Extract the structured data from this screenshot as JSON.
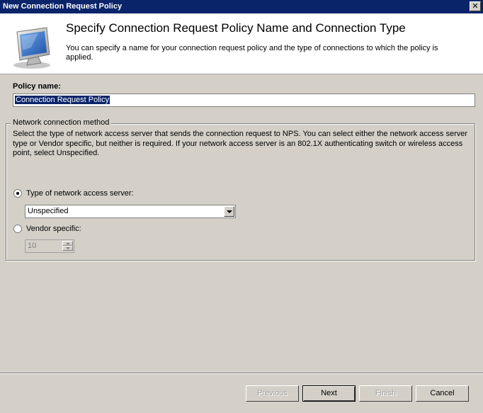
{
  "window": {
    "title": "New Connection Request Policy",
    "close_glyph": "✕"
  },
  "header": {
    "icon": "monitor-icon",
    "title": "Specify Connection Request Policy Name and Connection Type",
    "description": "You can specify a name for your connection request policy and the type of connections to which the policy is applied."
  },
  "policy": {
    "label": "Policy name:",
    "value": "Connection Request Policy"
  },
  "connection_method": {
    "legend": "Network connection method",
    "description": "Select the type of network access server that sends the connection request to NPS. You can select either the network access server type or Vendor specific, but neither is required.  If your network access server is an 802.1X authenticating switch or wireless access point, select Unspecified.",
    "type_option_label": "Type of network access server:",
    "type_selected": true,
    "type_value": "Unspecified",
    "vendor_option_label": "Vendor specific:",
    "vendor_selected": false,
    "vendor_value": "10"
  },
  "buttons": {
    "previous": "Previous",
    "next": "Next",
    "finish": "Finish",
    "cancel": "Cancel"
  },
  "colors": {
    "titlebar": "#0a246a",
    "dialog_bg": "#d4d0c8",
    "selection": "#0a246a"
  }
}
